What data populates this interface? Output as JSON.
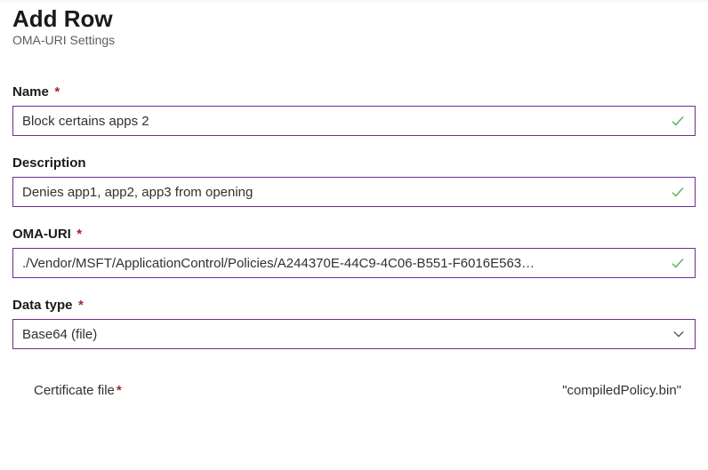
{
  "header": {
    "title": "Add Row",
    "subtitle": "OMA-URI Settings"
  },
  "fields": {
    "name": {
      "label": "Name",
      "required_mark": "*",
      "value": "Block certains apps 2"
    },
    "description": {
      "label": "Description",
      "value": "Denies app1, app2, app3 from opening"
    },
    "oma_uri": {
      "label": "OMA-URI",
      "required_mark": "*",
      "value": "./Vendor/MSFT/ApplicationControl/Policies/A244370E-44C9-4C06-B551-F6016E563…"
    },
    "data_type": {
      "label": "Data type",
      "required_mark": "*",
      "value": "Base64 (file)"
    }
  },
  "certificate": {
    "label": "Certificate file",
    "required_mark": "*",
    "filename": "\"compiledPolicy.bin\""
  },
  "colors": {
    "border": "#712e8c",
    "required": "#a4262c",
    "check": "#5fb25f"
  }
}
